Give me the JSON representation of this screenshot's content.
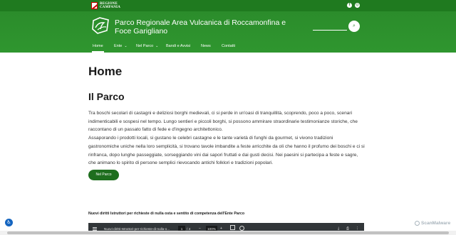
{
  "topbar": {
    "region_line1": "REGIONE",
    "region_line2": "CAMPANIA",
    "social": [
      {
        "icon": "facebook-icon",
        "glyph": "f"
      },
      {
        "icon": "instagram-icon",
        "glyph": "◎"
      }
    ]
  },
  "header": {
    "site_title": "Parco Regionale Area Vulcanica di Roccamonfina e Foce Garigliano",
    "search": {
      "value": "",
      "placeholder": "",
      "button_glyph": "⌕"
    }
  },
  "nav": {
    "items": [
      {
        "label": "Home",
        "active": true,
        "dropdown": false
      },
      {
        "label": "Ente",
        "active": false,
        "dropdown": true
      },
      {
        "label": "Nel Parco",
        "active": false,
        "dropdown": true
      },
      {
        "label": "Bandi e Avvisi",
        "active": false,
        "dropdown": false
      },
      {
        "label": "News",
        "active": false,
        "dropdown": false
      },
      {
        "label": "Contatti",
        "active": false,
        "dropdown": false
      }
    ],
    "chevron": "⌄"
  },
  "main": {
    "page_title": "Home",
    "section_title": "Il Parco",
    "body": "Tra boschi secolari di castagni e deliziosi borghi medievali, ci si perde in un'oasi di tranquillità, scoprendo, poco a poco, scenari indimenticabili e sospesi nel tempo. Lungo sentieri e piccoli borghi, si possono ammirare straordinarie testimonianze storiche, che raccontano di un passato fatto di fede e d'ingegno architettonico.\nAssaporando i prodotti locali, si gustano le celebri castagne e le tante varietà di funghi da gourmet, si vivono tradizioni gastronomiche uniche nella loro semplicità, si trovano tavole imbandite a feste arricchite da oli che hanno il profumo dei boschi e ci si rinfranca, dopo lunghe passeggiate, sorseggiando vini dai sapori fruttati e dai gusti decisi. Nei paesini si partecipa a feste e sagre, che animano lo spirito di persone semplici rievocando antichi folklori e tradizioni popolari.",
    "cta_label": "Nel Parco",
    "doc_title": "Nuovi diritti Istruttori per richieste di nulla osta e sentito di competenza dell'Ente Parco"
  },
  "pdf_viewer": {
    "file_name": "Nuovi-diritti-Istruttori-per-richieste-di-nulla-o...",
    "current_page": "1",
    "page_separator": "/",
    "total_pages": "4",
    "zoom": "100%",
    "zoom_out": "−",
    "zoom_in": "+",
    "actions": [
      "⤓",
      "⎙",
      "⋮"
    ]
  },
  "accessibility_button": "♿",
  "watermark": "ScanMalware",
  "colors": {
    "topbar": "#1f7a1f",
    "header": "#2e8b2e",
    "cta": "#1e6e1e",
    "accessibility": "#1565c0"
  }
}
